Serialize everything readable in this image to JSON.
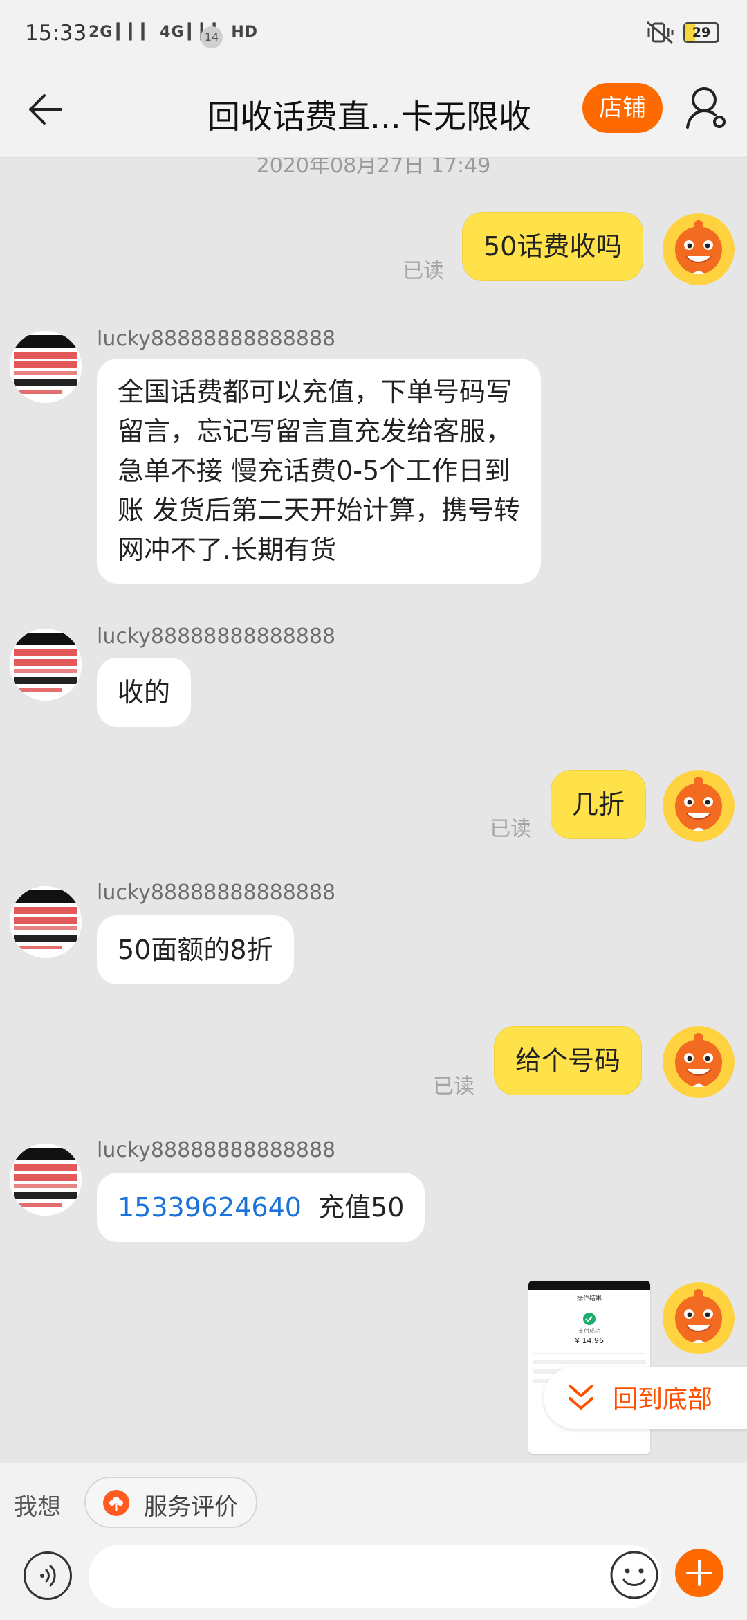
{
  "status_bar": {
    "time": "15:33",
    "signal": "2G ▎▎▎ 4G ▎▎▎ HD",
    "badge": "14",
    "battery": "29"
  },
  "header": {
    "title": "回收话费直...卡无限收",
    "shop_label": "店铺"
  },
  "chat": {
    "timestamp": "2020年08月27日 17:49",
    "read_label": "已读",
    "messages": [
      {
        "from": "me",
        "text": "50话费收吗",
        "read": "已读"
      },
      {
        "from": "them",
        "username": "lucky88888888888888",
        "lines": [
          "全国话费都可以充值，下单号码写",
          "留言，忘记写留言直充发给客服，",
          "急单不接 慢充话费0-5个工作日到",
          "账 发货后第二天开始计算，携号转",
          "网冲不了.长期有货"
        ]
      },
      {
        "from": "them",
        "username": "lucky88888888888888",
        "text": "收的"
      },
      {
        "from": "me",
        "text": "几折",
        "read": "已读"
      },
      {
        "from": "them",
        "username": "lucky88888888888888",
        "text": "50面额的8折"
      },
      {
        "from": "me",
        "text": "给个号码",
        "read": "已读"
      },
      {
        "from": "them",
        "username": "lucky88888888888888",
        "link": "15339624640",
        "text": "充值50"
      },
      {
        "from": "me",
        "type": "image",
        "shot_title": "操作结果",
        "shot_status": "支付成功",
        "shot_amount": "¥ 14.96"
      }
    ],
    "avatar_text": {
      "line1": "大量回收",
      "line2": "话费直冲",
      "line3": "各种话费充值卡",
      "line4": "快速结算 长期收购"
    }
  },
  "jump_to_bottom": "回到底部",
  "bottom_bar": {
    "quick_label": "我想",
    "review_label": "服务评价"
  },
  "colors": {
    "accent": "#ff6a00",
    "my_bubble": "#ffe24a",
    "link": "#1a73d9",
    "background": "#e6e6e6"
  }
}
